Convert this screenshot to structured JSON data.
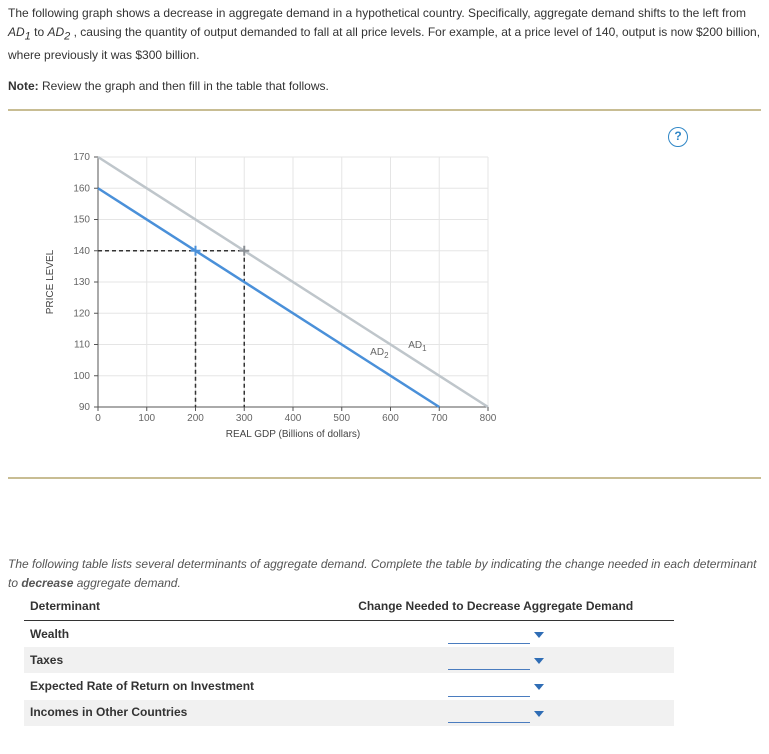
{
  "intro": {
    "part1": "The following graph shows a decrease in aggregate demand in a hypothetical country. Specifically, aggregate demand shifts to the left from ",
    "ad1": "AD",
    "ad1sub": "1",
    "part2": " to ",
    "ad2": "AD",
    "ad2sub": "2",
    "part3": ", causing the quantity of output demanded to fall at all price levels. For example, at a price level of 140, output is now $200 billion, where previously it was $300 billion."
  },
  "note": {
    "label": "Note:",
    "text": " Review the graph and then fill in the table that follows."
  },
  "help_icon": "?",
  "chart_data": {
    "type": "line",
    "xlabel": "REAL GDP (Billions of dollars)",
    "ylabel": "PRICE LEVEL",
    "x_ticks": [
      0,
      100,
      200,
      300,
      400,
      500,
      600,
      700,
      800
    ],
    "y_ticks": [
      90,
      100,
      110,
      120,
      130,
      140,
      150,
      160,
      170
    ],
    "xlim": [
      0,
      800
    ],
    "ylim": [
      90,
      170
    ],
    "series": [
      {
        "name": "AD1",
        "label": "AD",
        "sub": "1",
        "color": "#bfc6cb",
        "points": [
          [
            0,
            170
          ],
          [
            800,
            90
          ]
        ]
      },
      {
        "name": "AD2",
        "label": "AD",
        "sub": "2",
        "color": "#4a90d9",
        "points": [
          [
            0,
            160
          ],
          [
            700,
            90
          ]
        ]
      }
    ],
    "annotations": {
      "horizontal_ref_y": 140,
      "vlines_x": [
        200,
        300
      ],
      "marker_ad2": [
        200,
        140
      ],
      "marker_ad1": [
        300,
        140
      ]
    }
  },
  "question": {
    "part1": "The following table lists several determinants of aggregate demand. Complete the table by indicating the change needed in each determinant to ",
    "bold": "decrease",
    "part2": " aggregate demand."
  },
  "table": {
    "headers": [
      "Determinant",
      "Change Needed to Decrease Aggregate Demand"
    ],
    "rows": [
      {
        "label": "Wealth"
      },
      {
        "label": "Taxes"
      },
      {
        "label": "Expected Rate of Return on Investment"
      },
      {
        "label": "Incomes in Other Countries"
      }
    ]
  }
}
